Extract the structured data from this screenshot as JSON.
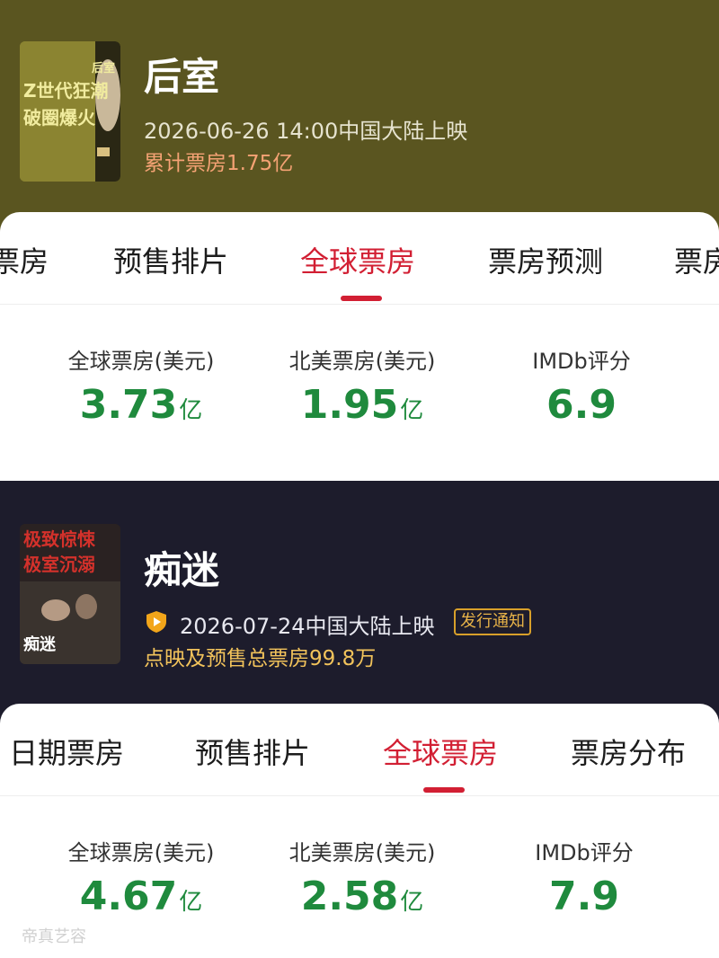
{
  "movies": [
    {
      "title": "后室",
      "release": "2026-06-26 14:00中国大陆上映",
      "box_office": "累计票房1.75亿",
      "poster_text": [
        "Z世代狂潮",
        "破圈爆火",
        "后室"
      ],
      "tabs": [
        "票房",
        "预售排片",
        "全球票房",
        "票房预测",
        "票房"
      ],
      "active_tab": 2,
      "stats": [
        {
          "label": "全球票房(美元)",
          "value": "3.73",
          "unit": "亿"
        },
        {
          "label": "北美票房(美元)",
          "value": "1.95",
          "unit": "亿"
        },
        {
          "label": "IMDb评分",
          "value": "6.9",
          "unit": ""
        }
      ]
    },
    {
      "title": "痴迷",
      "release": "2026-07-24中国大陆上映",
      "badge": "发行通知",
      "box_office": "点映及预售总票房99.8万",
      "poster_text": [
        "极致惊悚",
        "极室沉溺",
        "痴迷"
      ],
      "tabs": [
        "日期票房",
        "预售排片",
        "全球票房",
        "票房分布"
      ],
      "active_tab": 2,
      "stats": [
        {
          "label": "全球票房(美元)",
          "value": "4.67",
          "unit": "亿"
        },
        {
          "label": "北美票房(美元)",
          "value": "2.58",
          "unit": "亿"
        },
        {
          "label": "IMDb评分",
          "value": "7.9",
          "unit": ""
        }
      ]
    }
  ],
  "watermark": "帝真艺容",
  "colors": {
    "movie1_bg": "#5a5520",
    "movie2_bg": "#1d1c2c",
    "accent_red": "#d21f33",
    "stat_green": "#1f8a3d",
    "box_office_orange": "#f4a274",
    "box_office_gold": "#f2c35b"
  }
}
